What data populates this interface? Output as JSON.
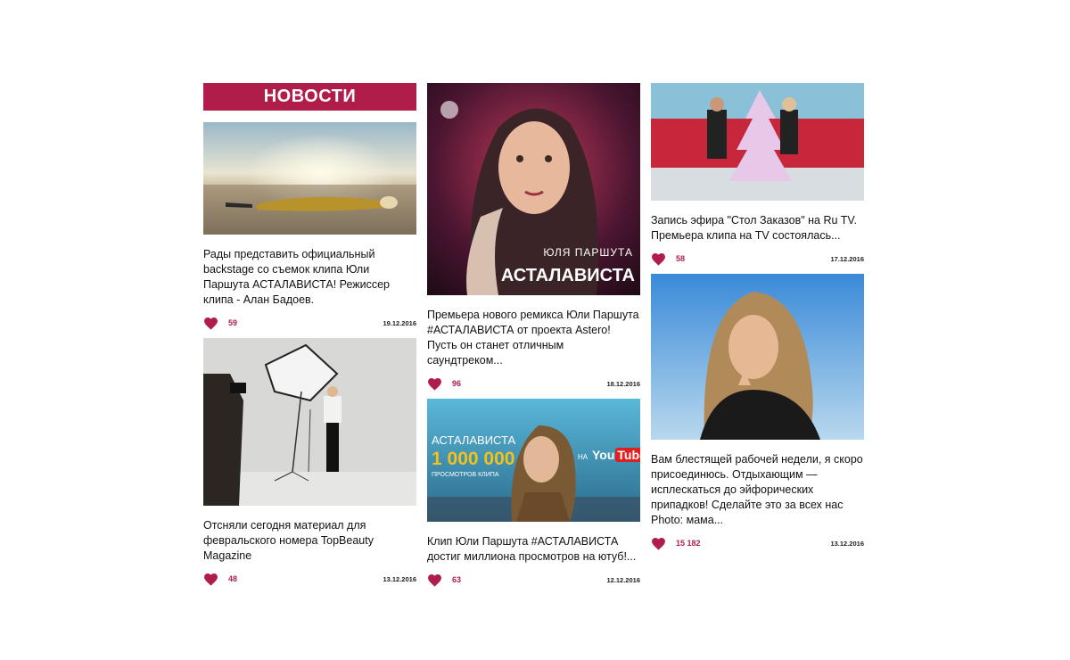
{
  "header": {
    "title": "НОВОСТИ"
  },
  "posts": [
    {
      "caption": "Рады представить официальный backstage со съемок клипа Юли Паршута АСТАЛАВИСТА! Режиссер клипа - Алан Бадоев.",
      "likes": "59",
      "date": "19.12.2016",
      "image": "beach-photo"
    },
    {
      "caption": "Отсняли сегодня материал для февральского номера TopBeauty Magazine",
      "likes": "48",
      "date": "13.12.2016",
      "image": "studio-photo"
    },
    {
      "caption": "Премьера нового ремикса Юли Паршута #АСТАЛАВИСТА от проекта Astero! Пусть он станет отличным саундтреком...",
      "likes": "96",
      "date": "18.12.2016",
      "image": "album-cover",
      "overlay": {
        "artist": "ЮЛЯ ПАРШУТА",
        "title": "АСТАЛАВИСТА"
      }
    },
    {
      "caption": "Клип Юли Паршута #АСТАЛАВИСТА достиг миллиона просмотров на ютуб!...",
      "likes": "63",
      "date": "12.12.2016",
      "image": "youtube-banner",
      "overlay": {
        "title": "АСТАЛАВИСТА",
        "count": "1 000 000",
        "sub": "ПРОСМОТРОВ КЛИПА",
        "na": "НА",
        "you": "You",
        "tube": "Tube"
      }
    },
    {
      "caption": "Запись эфира \"Стол Заказов\" на Ru TV. Премьера клипа на TV состоялась...",
      "likes": "58",
      "date": "17.12.2016",
      "image": "tv-studio-photo"
    },
    {
      "caption": "Вам блестящей рабочей недели, я скоро присоединюсь. Отдыхающим — исплескаться до эйфорических припадков! Сделайте это за всех нас Photo: мама...",
      "likes": "15 182",
      "date": "13.12.2016",
      "image": "portrait-photo"
    }
  ],
  "colors": {
    "accent": "#b01d4a",
    "background": "#ffffff"
  }
}
